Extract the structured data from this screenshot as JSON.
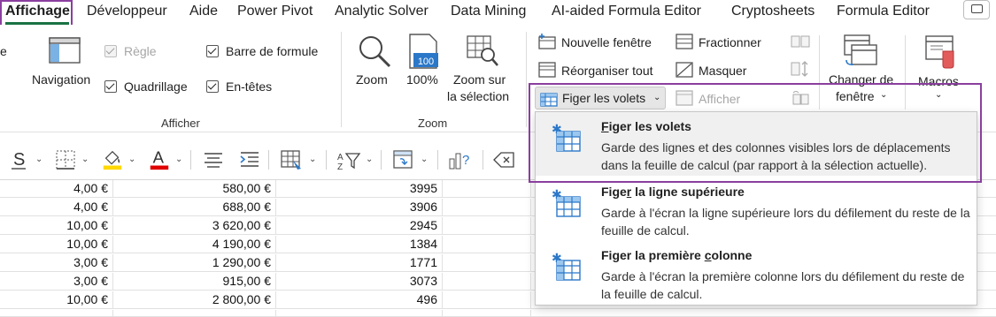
{
  "tabs": [
    "Affichage",
    "Développeur",
    "Aide",
    "Power Pivot",
    "Analytic Solver",
    "Data Mining",
    "AI-aided Formula Editor",
    "Cryptosheets",
    "Formula Editor"
  ],
  "ribbon": {
    "partial_left": "e",
    "navigation_label": "Navigation",
    "regle_label": "Règle",
    "quadrillage_label": "Quadrillage",
    "barre_formule_label": "Barre de formule",
    "entetes_label": "En-têtes",
    "afficher_group": "Afficher",
    "zoom_label": "Zoom",
    "zoom100_label": "100%",
    "zoom_sel_line1": "Zoom sur",
    "zoom_sel_line2": "la sélection",
    "zoom_group": "Zoom",
    "nouvelle_fenetre": "Nouvelle fenêtre",
    "reorganiser_tout": "Réorganiser tout",
    "figer_volets": "Figer les volets",
    "fractionner": "Fractionner",
    "masquer": "Masquer",
    "afficher_btn": "Afficher",
    "changer_fenetre_line1": "Changer de",
    "changer_fenetre_line2": "fenêtre",
    "macros": "Macros"
  },
  "menu": {
    "items": [
      {
        "title_pre": "",
        "title_ul": "F",
        "title_post": "iger les volets",
        "desc": "Garde des lignes et des colonnes visibles lors de déplacements dans la feuille de calcul (par rapport à la sélection actuelle)."
      },
      {
        "title_pre": "Fige",
        "title_ul": "r",
        "title_post": " la ligne supérieure",
        "desc": "Garde à l'écran la ligne supérieure lors du défilement du reste de la feuille de calcul."
      },
      {
        "title_pre": "Figer la première ",
        "title_ul": "c",
        "title_post": "olonne",
        "desc": "Garde à l'écran la première colonne lors du défilement du reste de la feuille de calcul."
      }
    ]
  },
  "grid": {
    "rows": [
      [
        "4,00 €",
        "580,00 €",
        "3995"
      ],
      [
        "4,00 €",
        "688,00 €",
        "3906"
      ],
      [
        "10,00 €",
        "3 620,00 €",
        "2945"
      ],
      [
        "10,00 €",
        "4 190,00 €",
        "1384"
      ],
      [
        "3,00 €",
        "1 290,00 €",
        "1771"
      ],
      [
        "3,00 €",
        "915,00 €",
        "3073"
      ],
      [
        "10,00 €",
        "2 800,00 €",
        "496"
      ]
    ]
  },
  "colors": {
    "highlight": "#8a3f9e",
    "font_color_bar": "#e00000",
    "fill_color_bar": "#ffd800",
    "icon_blue": "#2b78c9",
    "active_tab_underline": "#1a7343"
  }
}
